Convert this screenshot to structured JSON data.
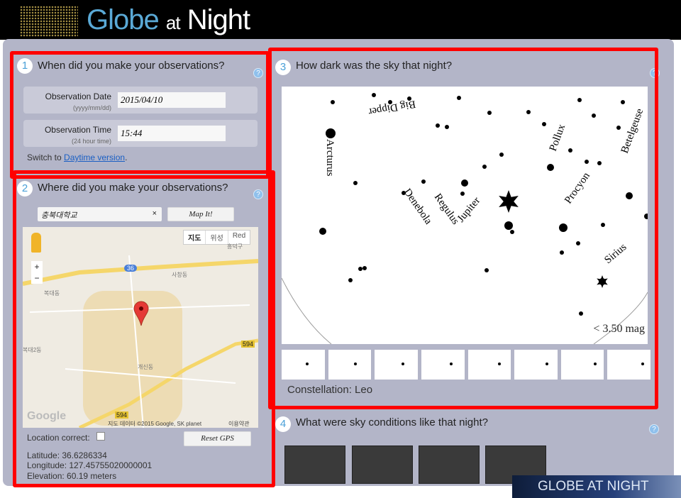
{
  "header": {
    "logo_globe": "Globe",
    "logo_at": "at",
    "logo_night": "Night"
  },
  "section1": {
    "number": "1",
    "title": "When did you make your observations?",
    "help": "?",
    "date_label": "Observation Date",
    "date_hint": "(yyyy/mm/dd)",
    "date_value": "2015/04/10",
    "time_label": "Observation Time",
    "time_hint": "(24 hour time)",
    "time_value": "15:44",
    "switch_text": "Switch to ",
    "switch_link": "Daytime version",
    "switch_end": "."
  },
  "section2": {
    "number": "2",
    "title": "Where did you make your observations?",
    "help": "?",
    "search_value": "충북대학교",
    "clear": "×",
    "map_it": "Map It!",
    "map": {
      "types": [
        "지도",
        "위성",
        "Red"
      ],
      "zoom_in": "+",
      "zoom_out": "−",
      "road_36": "36",
      "road_594a": "594",
      "road_594b": "594",
      "labels": [
        "흥덕구",
        "사창동",
        "복대동",
        "복대2동",
        "개신동"
      ],
      "attribution": "지도 데이터 ©2015 Google, SK planet",
      "terms": "이용약관",
      "google": "Google"
    },
    "location_correct": "Location correct:",
    "reset_gps": "Reset GPS",
    "latitude": "Latitude: 36.6286334",
    "longitude": "Longitude: 127.45755020000001",
    "elevation": "Elevation: 60.19 meters"
  },
  "section3": {
    "number": "3",
    "title": "How dark was the sky that night?",
    "help": "?",
    "star_labels": [
      "Big Dipper",
      "Arcturus",
      "Pollux",
      "Betelgeuse",
      "Denebola",
      "Regulus",
      "Jupiter",
      "Procyon",
      "Sirius"
    ],
    "magnitude": "< 3.50 mag",
    "constellation": "Constellation: Leo",
    "selected_magnitude": 3.5
  },
  "section4": {
    "number": "4",
    "title": "What were sky conditions like that night?",
    "help": "?"
  },
  "footer": {
    "logo": "GLOBE AT NIGHT"
  },
  "colors": {
    "highlight": "#ff0000",
    "panel": "#b3b5c8",
    "accent": "#4aa0d8"
  }
}
